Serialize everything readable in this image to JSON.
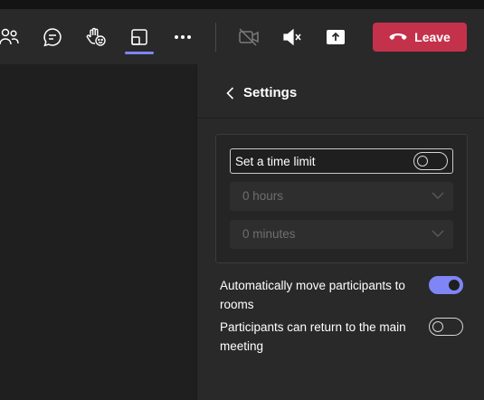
{
  "toolbar": {
    "icons": [
      "people-icon",
      "chat-icon",
      "raise-hand-icon",
      "rooms-icon",
      "more-icon",
      "camera-off-icon",
      "speaker-muted-icon",
      "share-icon"
    ],
    "leave_label": "Leave",
    "active_item": "rooms-icon"
  },
  "panel": {
    "title": "Settings",
    "time_limit": {
      "label": "Set a time limit",
      "enabled": false,
      "hours_value": "0 hours",
      "minutes_value": "0 minutes"
    },
    "auto_move": {
      "label": "Automatically move participants to rooms",
      "enabled": true
    },
    "return_main": {
      "label": "Participants can return to the main meeting",
      "enabled": false
    }
  },
  "colors": {
    "leave": "#c4314b",
    "accent": "#7f85f5",
    "panel": "#292929",
    "stage": "#1f1f1f"
  }
}
